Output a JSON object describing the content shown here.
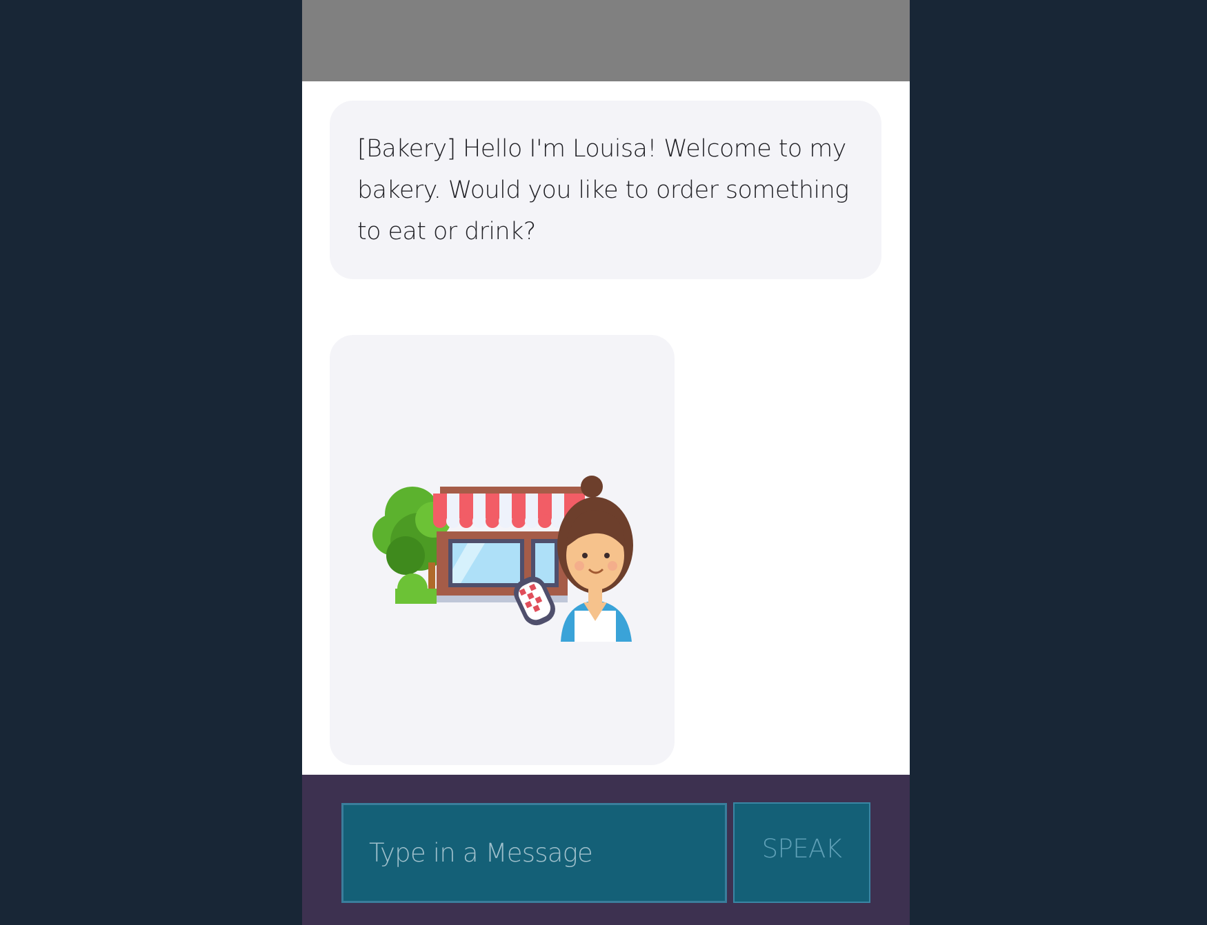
{
  "chat": {
    "messages": [
      {
        "type": "text",
        "text": "[Bakery] Hello I'm Louisa! Welcome to my bakery. Would you like to order something to eat or drink?"
      },
      {
        "type": "image",
        "icon": "bakery-shopkeeper-illustration"
      }
    ]
  },
  "composer": {
    "input_placeholder": "Type in a Message",
    "input_value": "",
    "speak_label": "SPEAK"
  },
  "colors": {
    "page_background": "#182636",
    "top_bar": "#808080",
    "bubble": "#f4f4f8",
    "composer_background": "#3d3150",
    "control_fill": "#146077",
    "control_border": "#3a7e9c"
  }
}
